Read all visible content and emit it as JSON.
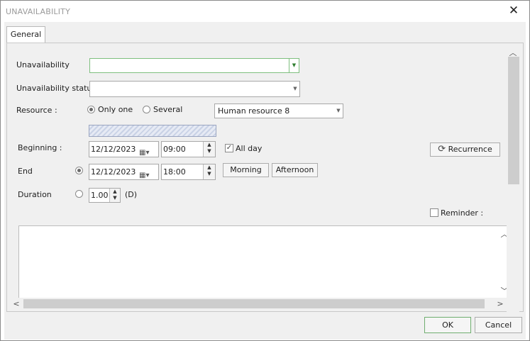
{
  "window": {
    "title": "UNAVAILABILITY"
  },
  "tabs": [
    {
      "label": "General"
    }
  ],
  "form": {
    "unavailability_label": "Unavailability",
    "unavailability_value": "",
    "status_label": "Unavailability status",
    "status_value": "",
    "resource_label": "Resource :",
    "resource_opt_one": "Only one",
    "resource_opt_several": "Several",
    "resource_selected": "Only one",
    "resource_value": "Human resource 8",
    "beginning_label": "Beginning :",
    "beginning_date": "12/12/2023",
    "beginning_time": "09:00",
    "all_day_label": "All day",
    "all_day_checked": true,
    "recurrence_label": "Recurrence",
    "end_label": "End",
    "end_date": "12/12/2023",
    "end_time": "18:00",
    "morning_label": "Morning",
    "afternoon_label": "Afternoon",
    "duration_label": "Duration",
    "duration_value": "1.00",
    "duration_unit": "(D)",
    "reminder_label": "Reminder :",
    "reminder_checked": false
  },
  "footer": {
    "ok_label": "OK",
    "cancel_label": "Cancel"
  },
  "colors": {
    "accent_green": "#3a9d3a",
    "hatch": "#c9d2e6"
  }
}
